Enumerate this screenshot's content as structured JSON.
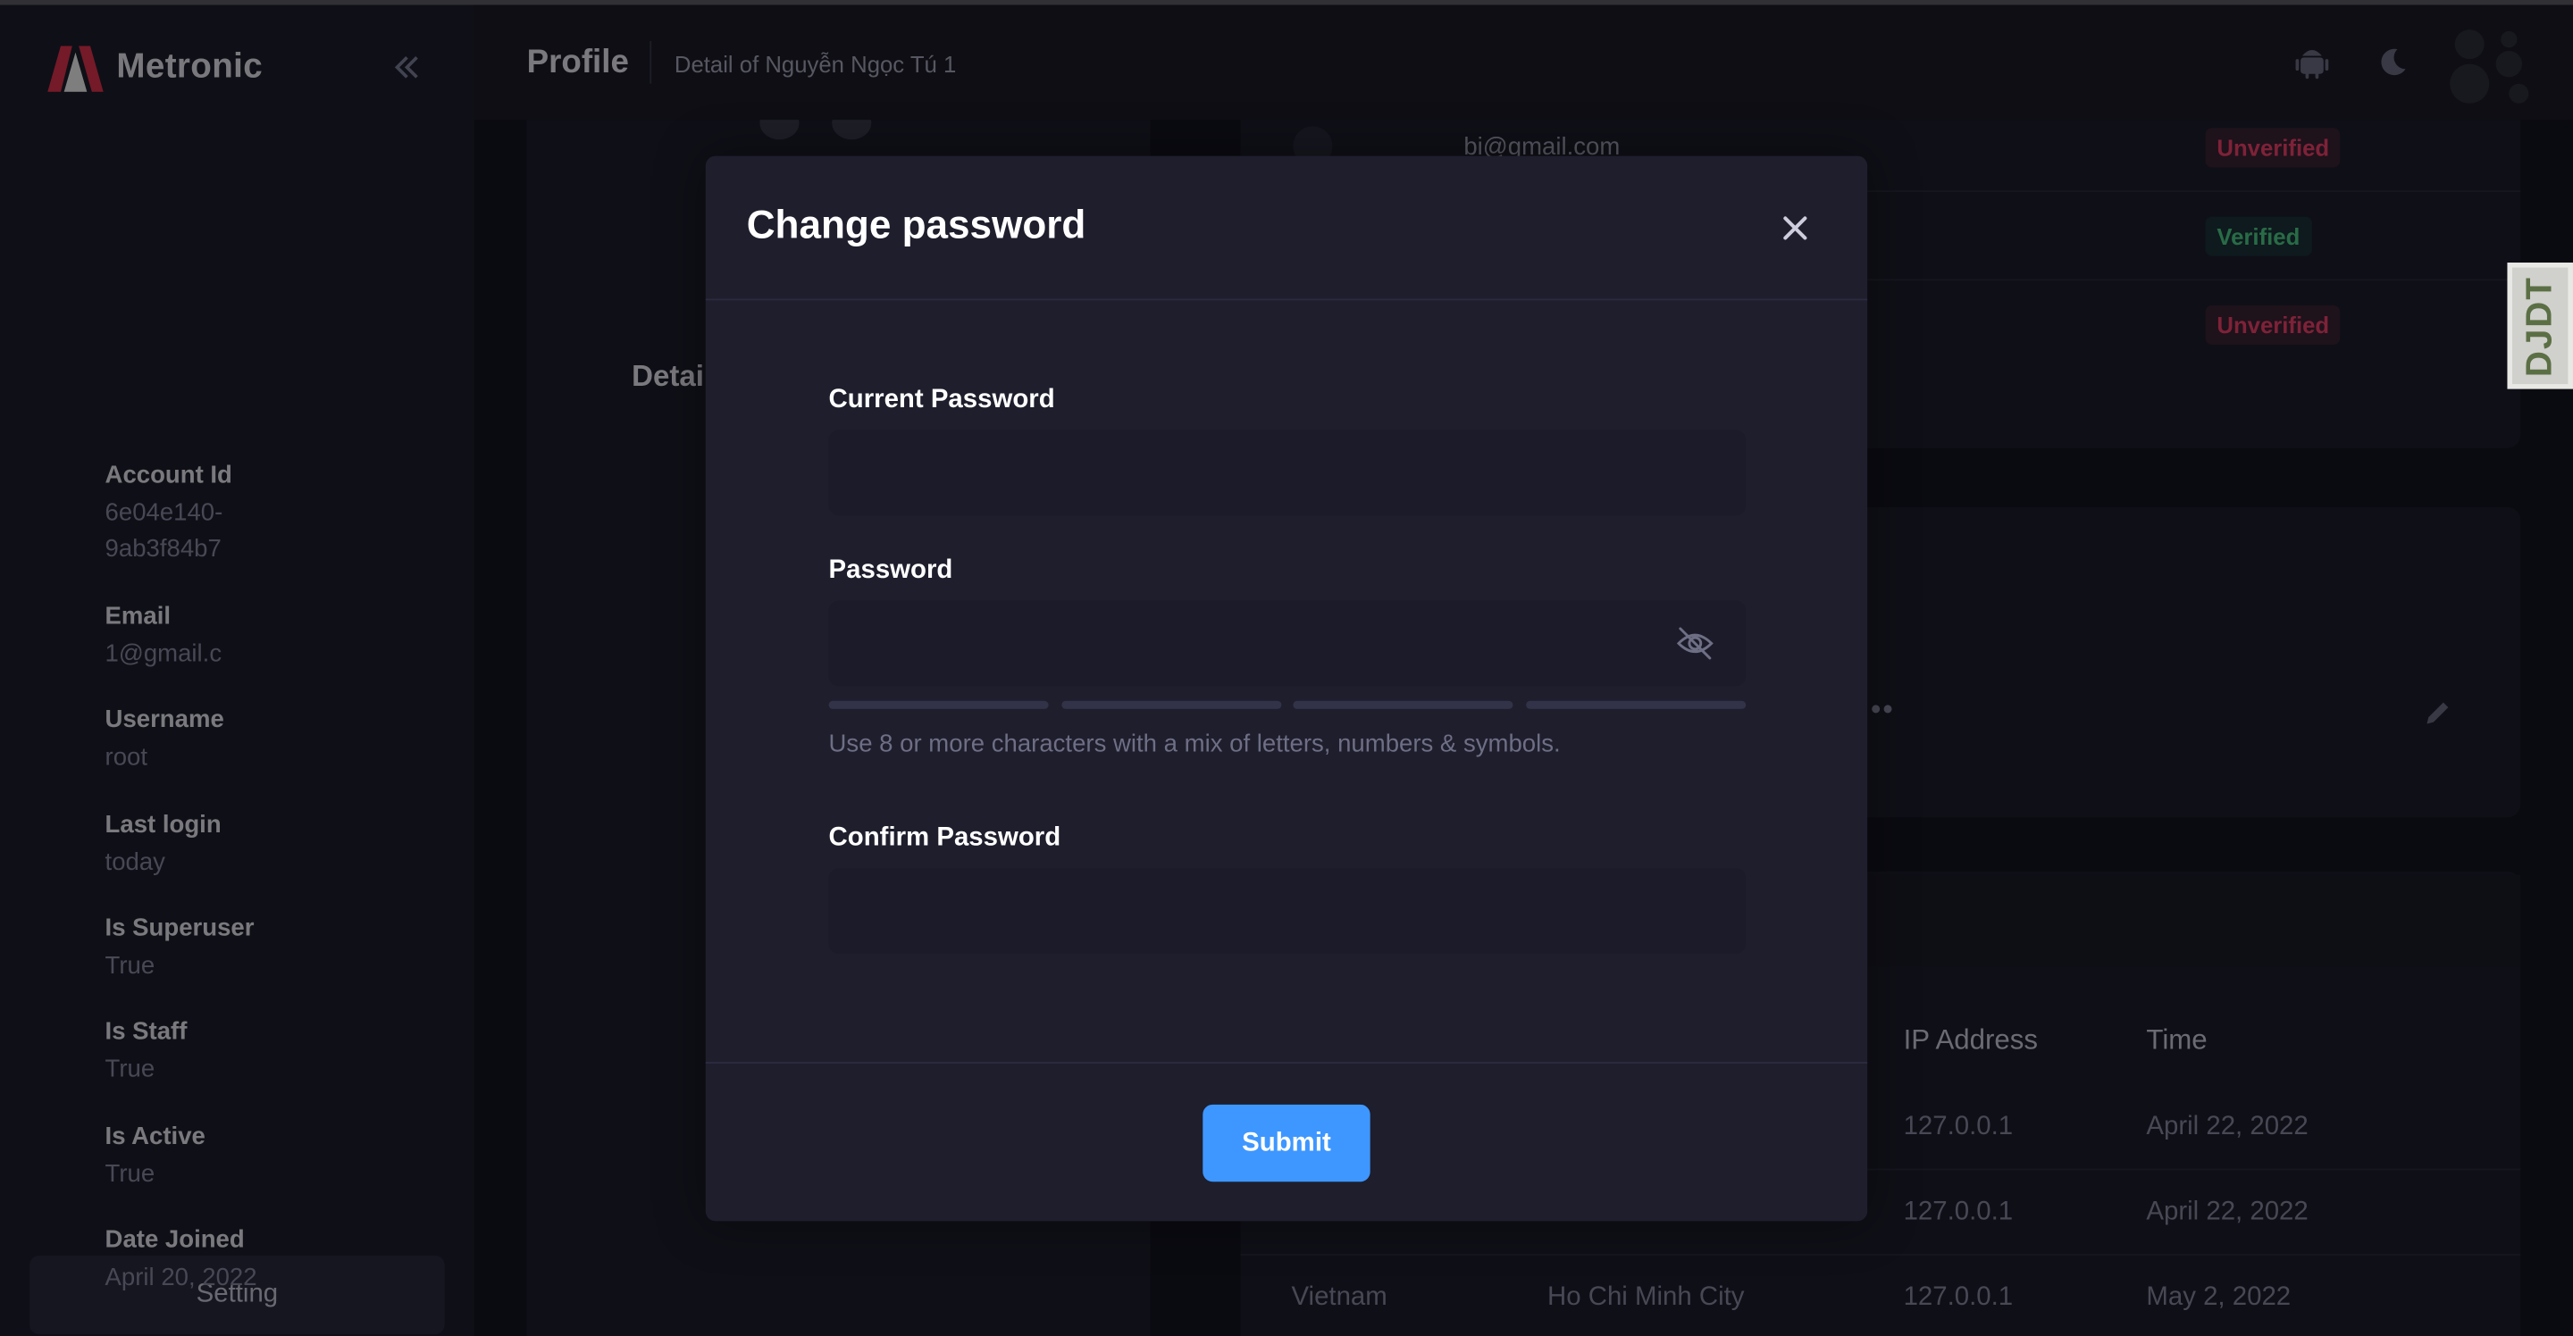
{
  "app": {
    "name": "Metronic",
    "brand_color": "#e0334d"
  },
  "header": {
    "title": "Profile",
    "breadcrumb": "Detail of Nguyễn Ngọc Tú 1",
    "icons": [
      "android-icon",
      "moon-icon",
      "avatar"
    ]
  },
  "sidebar": {
    "setting_label": "Setting"
  },
  "details": {
    "title": "Details",
    "fields": [
      {
        "label": "Account Id",
        "value": "6e04e140-\n9ab3f84b7"
      },
      {
        "label": "Email",
        "value": "1@gmail.c"
      },
      {
        "label": "Username",
        "value": "root"
      },
      {
        "label": "Last login",
        "value": "today"
      },
      {
        "label": "Is Superuser",
        "value": "True"
      },
      {
        "label": "Is Staff",
        "value": "True"
      },
      {
        "label": "Is Active",
        "value": "True"
      },
      {
        "label": "Date Joined",
        "value": "April 20, 2022"
      }
    ]
  },
  "emails": {
    "visible_email": "bi@gmail.com",
    "statuses": [
      "Unverified",
      "Verified",
      "Unverified"
    ]
  },
  "sessions_table": {
    "columns": [
      "IP Address",
      "Time"
    ],
    "rows": [
      {
        "country": "",
        "city": "",
        "ip": "127.0.0.1",
        "time": "April 22, 2022"
      },
      {
        "country": "",
        "city": "",
        "ip": "127.0.0.1",
        "time": "April 22, 2022"
      },
      {
        "country": "Vietnam",
        "city": "Ho Chi Minh City",
        "ip": "127.0.0.1",
        "time": "May 2, 2022"
      }
    ]
  },
  "debug_toolbar": {
    "label": "DJDT"
  },
  "modal": {
    "title": "Change password",
    "current_password_label": "Current Password",
    "current_password_value": "",
    "password_label": "Password",
    "password_value": "",
    "password_hint": "Use 8 or more characters with a mix of letters, numbers & symbols.",
    "strength_meter_filled": 0,
    "confirm_password_label": "Confirm Password",
    "confirm_password_value": "",
    "submit_label": "Submit",
    "accent_color": "#3e97ff"
  }
}
